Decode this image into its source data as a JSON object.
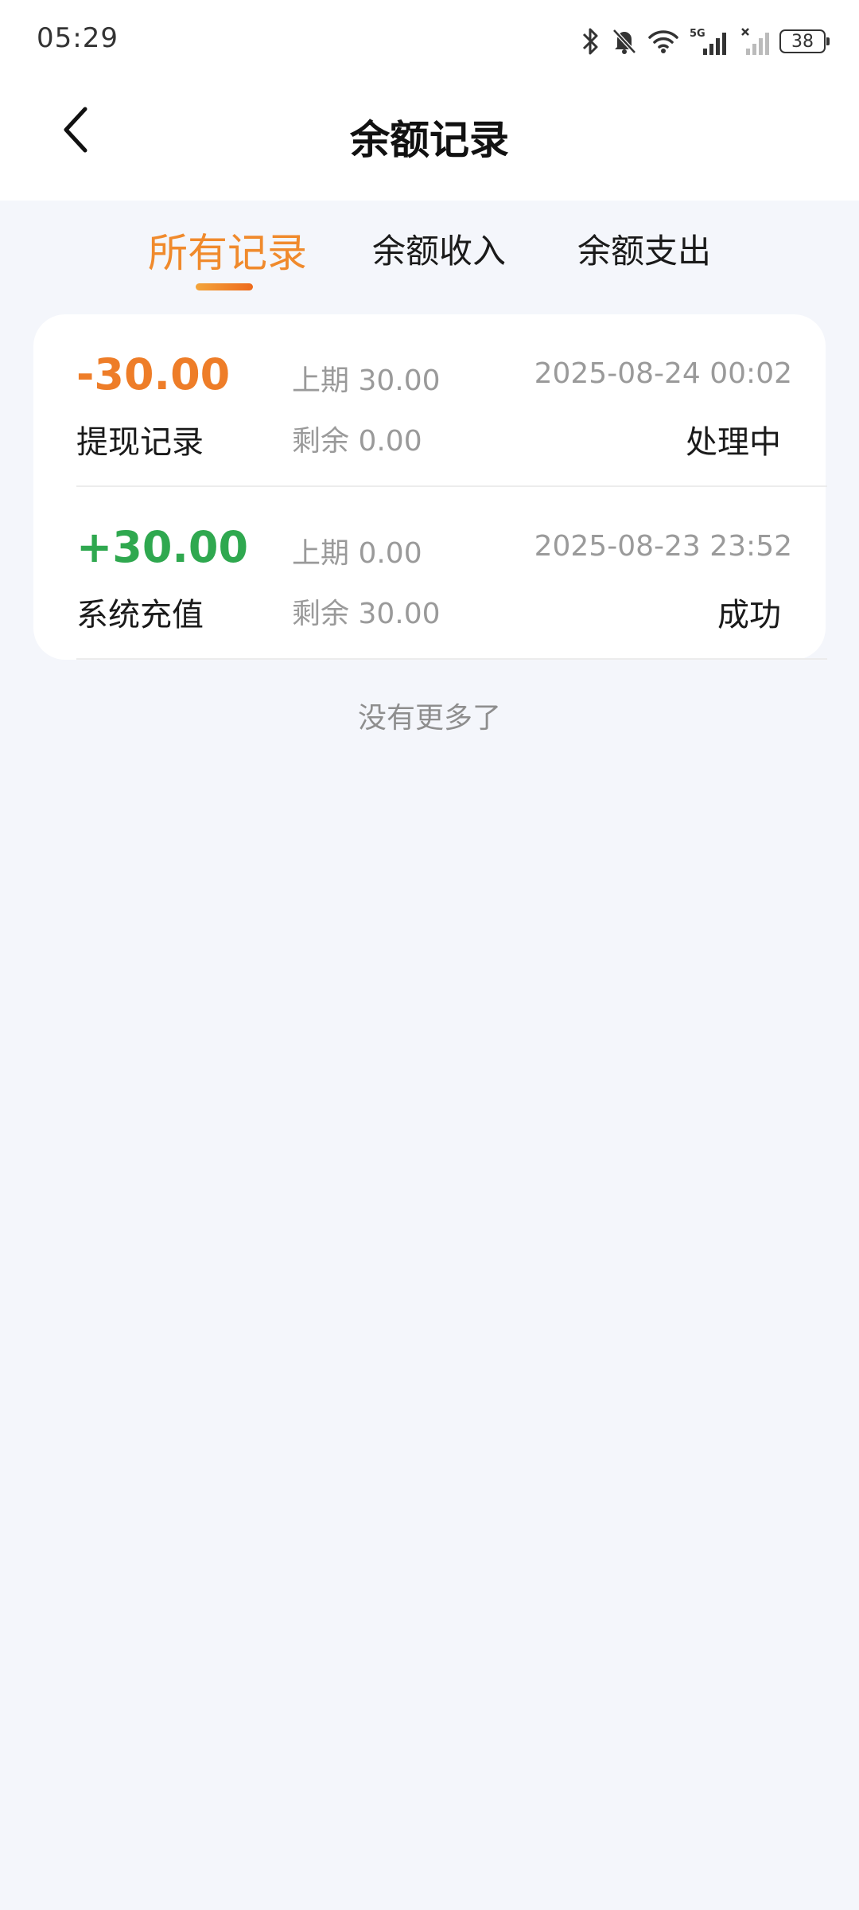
{
  "status_bar": {
    "time": "05:29",
    "battery": "38",
    "network_label": "5G",
    "icons": [
      "bluetooth-icon",
      "mute-bell-icon",
      "wifi-icon",
      "signal-5g-icon",
      "signal-no-sim-icon",
      "battery-icon"
    ]
  },
  "header": {
    "title": "余额记录",
    "back_icon": "chevron-left-icon"
  },
  "tabs": [
    {
      "label": "所有记录",
      "active": true
    },
    {
      "label": "余额收入",
      "active": false
    },
    {
      "label": "余额支出",
      "active": false
    }
  ],
  "records": [
    {
      "amount": "-30.00",
      "type": "提现记录",
      "prev": "上期 30.00",
      "remain": "剩余 0.00",
      "time": "2025-08-24 00:02",
      "status": "处理中",
      "color": "#ee7d28"
    },
    {
      "amount": "+30.00",
      "type": "系统充值",
      "prev": "上期 0.00",
      "remain": "剩余 30.00",
      "time": "2025-08-23 23:52",
      "status": "成功",
      "color": "#2fa84f"
    }
  ],
  "footer": {
    "no_more": "没有更多了"
  },
  "colors": {
    "accent": "#f08a2c",
    "negative": "#ee7d28",
    "positive": "#2fa84f",
    "background": "#f4f6fb"
  }
}
